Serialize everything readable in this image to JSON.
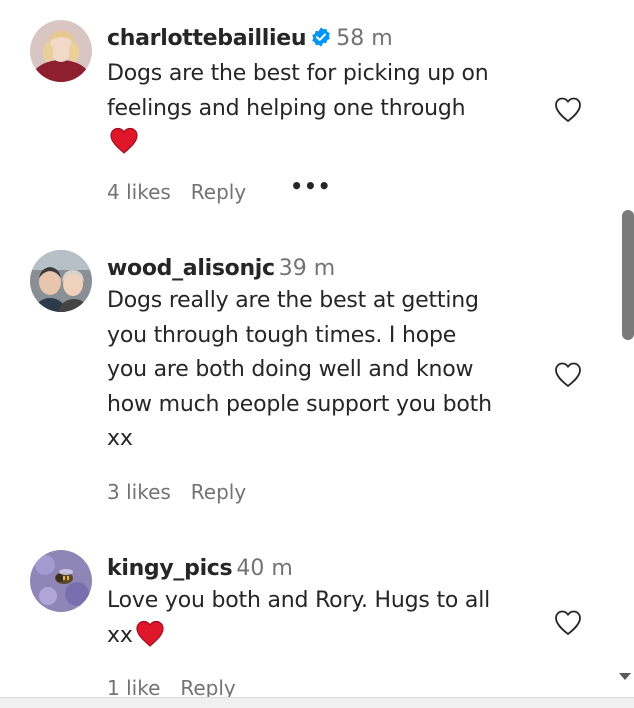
{
  "comments": [
    {
      "username": "charlottebaillieu",
      "verified": true,
      "time": "58 m",
      "lines": [
        "Dogs are the best for picking up on",
        "feelings and helping one through"
      ],
      "emoji": "red-heart-emoji",
      "likes": "4 likes",
      "reply": "Reply",
      "more": "•••"
    },
    {
      "username": "wood_alisonjc",
      "verified": false,
      "time": "39 m",
      "lines": [
        "Dogs really are the best at getting",
        "you through tough times. I hope",
        "you are both doing well and know",
        "how much people support you both",
        "xx"
      ],
      "likes": "3 likes",
      "reply": "Reply"
    },
    {
      "username": "kingy_pics",
      "verified": false,
      "time": "40 m",
      "lines": [
        "Love you both and Rory. Hugs to all",
        "xx"
      ],
      "emoji": "red-heart-emoji",
      "likes": "1 like",
      "reply": "Reply"
    }
  ],
  "colors": {
    "text": "#262626",
    "muted": "#737373",
    "verified_blue": "#0095f6",
    "heart_red": "#e0162b",
    "scroll_thumb": "#7a7a7a"
  },
  "icons": {
    "verified": "verified-badge-icon",
    "like": "heart-outline-icon",
    "more": "more-options-icon"
  }
}
